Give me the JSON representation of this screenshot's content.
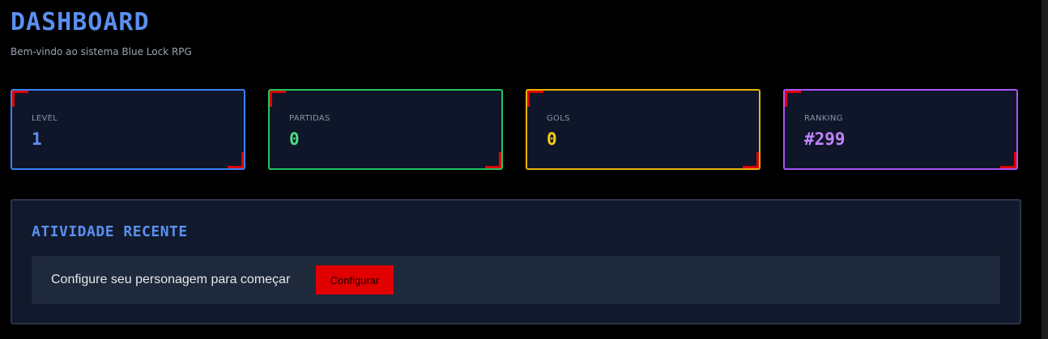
{
  "header": {
    "title": "DASHBOARD",
    "subtitle": "Bem-vindo ao sistema Blue Lock RPG"
  },
  "stats": [
    {
      "label": "LEVEL",
      "value": "1",
      "color": "#5b8ff0",
      "border_color": "#3b82f6"
    },
    {
      "label": "PARTIDAS",
      "value": "0",
      "color": "#4ade80",
      "border_color": "#22c55e"
    },
    {
      "label": "GOLS",
      "value": "0",
      "color": "#facc15",
      "border_color": "#eab308"
    },
    {
      "label": "RANKING",
      "value": "#299",
      "color": "#c084fc",
      "border_color": "#a855f7"
    }
  ],
  "activity": {
    "title": "ATIVIDADE RECENTE",
    "message": "Configure seu personagem para começar",
    "button_label": "Configurar"
  },
  "colors": {
    "background": "#000000",
    "accent": "#e00000",
    "title": "#5b8ff0"
  }
}
